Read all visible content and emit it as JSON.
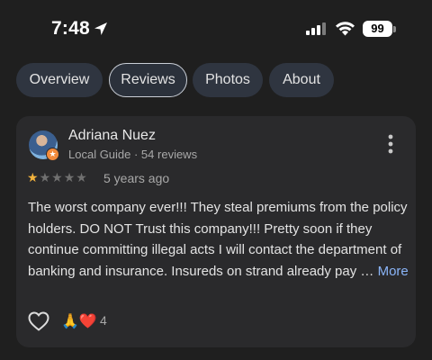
{
  "status_bar": {
    "time": "7:48",
    "battery": "99"
  },
  "tabs": [
    {
      "label": "Overview",
      "active": false
    },
    {
      "label": "Reviews",
      "active": true
    },
    {
      "label": "Photos",
      "active": false
    },
    {
      "label": "About",
      "active": false
    }
  ],
  "review": {
    "author": "Adriana Nuez",
    "subtitle": "Local Guide · 54 reviews",
    "rating": 1,
    "rating_max": 5,
    "age": "5 years ago",
    "text": "The worst company ever!!! They steal premiums from the policy holders. DO NOT Trust this company!!! Pretty soon if they continue committing illegal acts I will contact the department of banking and insurance. Insureds on strand already pay … ",
    "more_label": "More",
    "reaction_emoji": "🙏❤️",
    "reaction_count": "4"
  },
  "colors": {
    "background": "#1f1f1f",
    "card": "#2a2a2c",
    "tab": "#2f3540",
    "star": "#f3b33d",
    "link": "#8ab4f8"
  },
  "icons": [
    "location-arrow-icon",
    "signal-icon",
    "wifi-icon",
    "more-vertical-icon",
    "heart-icon",
    "local-guide-badge-icon"
  ]
}
